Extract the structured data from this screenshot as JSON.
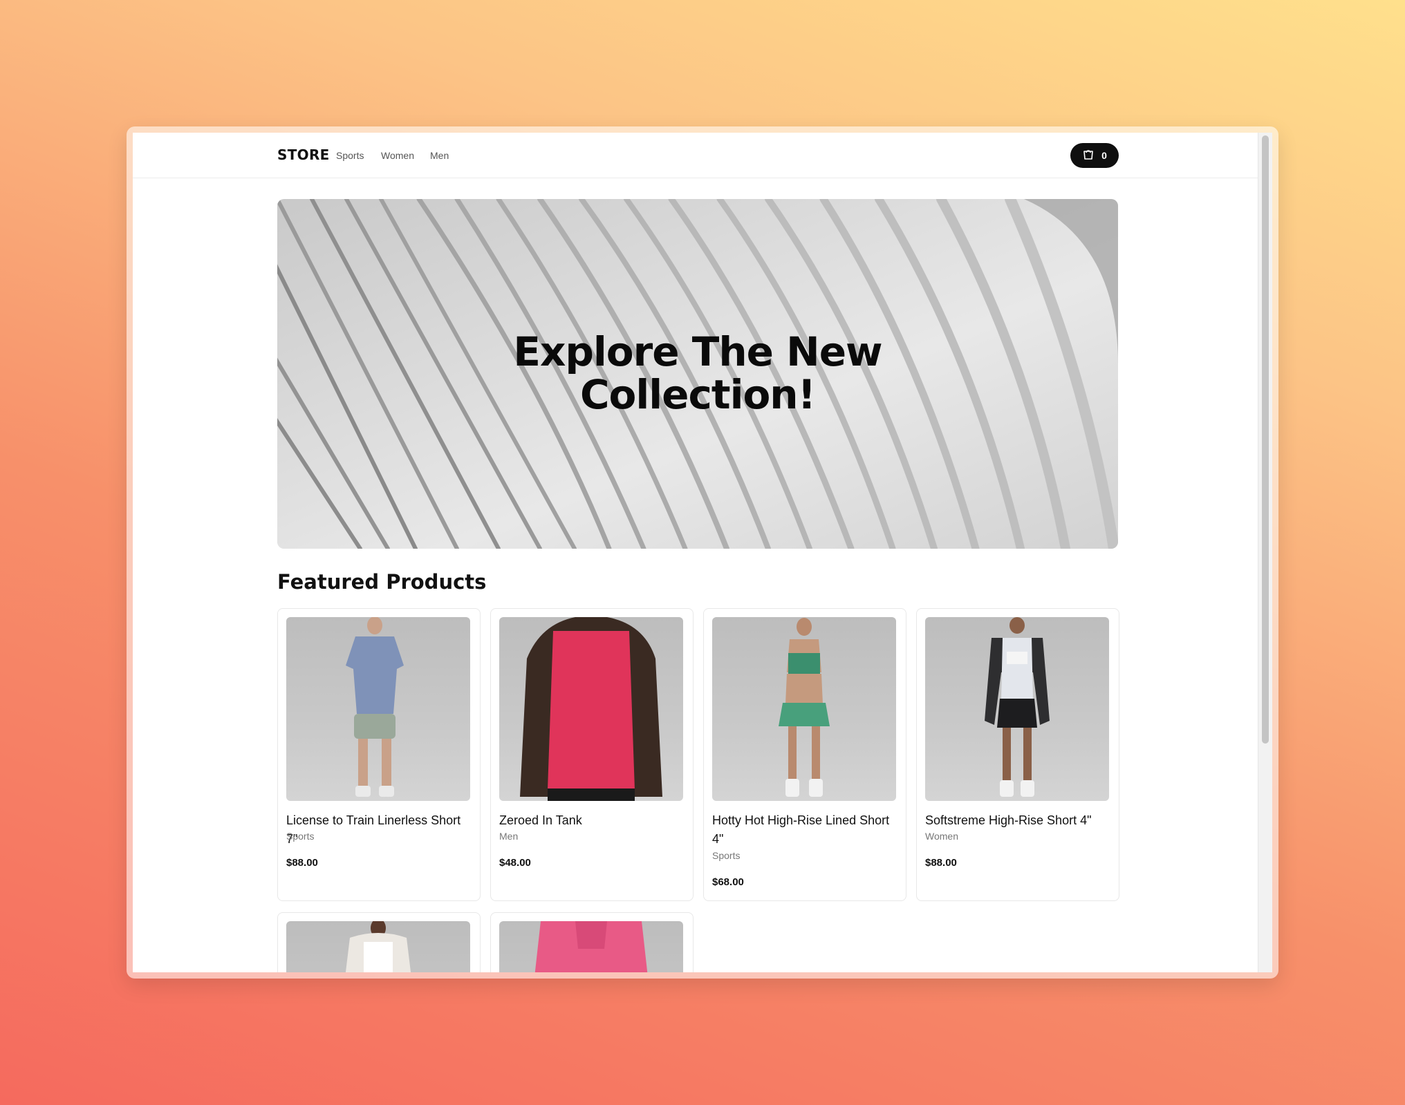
{
  "header": {
    "brand": "STORE",
    "nav": [
      "Sports",
      "Women",
      "Men"
    ],
    "cart_count": "0"
  },
  "hero": {
    "title_line1": "Explore The New",
    "title_line2": "Collection!"
  },
  "featured": {
    "title": "Featured Products",
    "products": [
      {
        "name": "License to Train Linerless Short 7\"",
        "category": "Sports",
        "price": "$88.00"
      },
      {
        "name": "Zeroed In Tank",
        "category": "Men",
        "price": "$48.00"
      },
      {
        "name": "Hotty Hot High-Rise Lined Short 4\"",
        "category": "Sports",
        "price": "$68.00"
      },
      {
        "name": "Softstreme High-Rise Short 4\"",
        "category": "Women",
        "price": "$88.00"
      }
    ]
  },
  "colors": {
    "accent": "#0f0f0f",
    "background_gradient": [
      "#f56a5e",
      "#ffe08c"
    ]
  }
}
